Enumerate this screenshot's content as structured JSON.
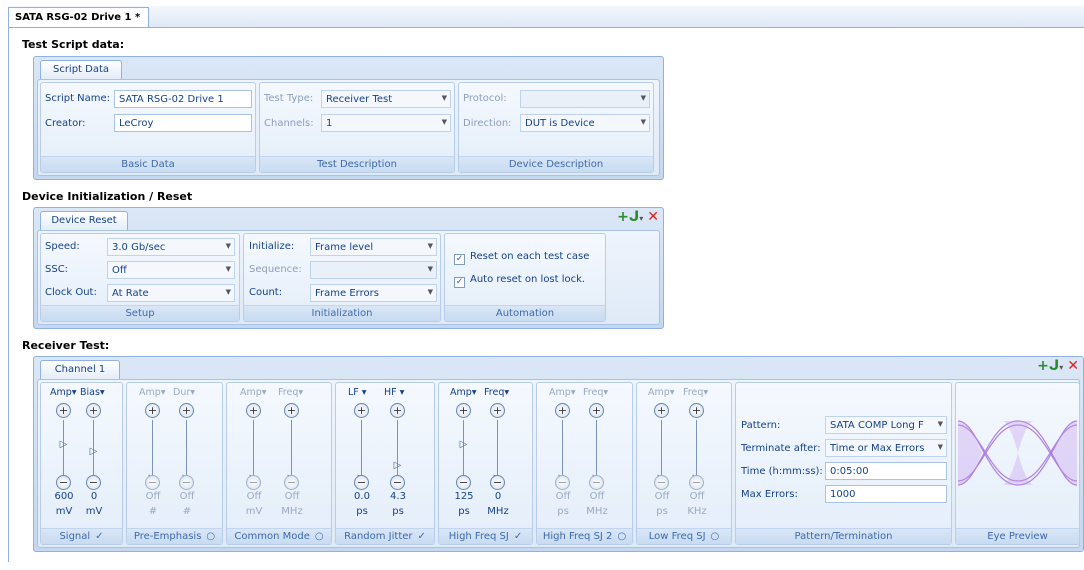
{
  "document_tab": "SATA RSG-02 Drive 1 *",
  "sections": {
    "test_script": "Test Script data:",
    "device_init": "Device Initialization / Reset",
    "receiver": "Receiver Test:"
  },
  "script_data": {
    "tab": "Script Data",
    "basic": {
      "script_name_label": "Script Name:",
      "script_name": "SATA RSG-02 Drive 1",
      "creator_label": "Creator:",
      "creator": "LeCroy",
      "group": "Basic Data"
    },
    "test_desc": {
      "test_type_label": "Test Type:",
      "test_type": "Receiver Test",
      "channels_label": "Channels:",
      "channels": "1",
      "group": "Test Description"
    },
    "device_desc": {
      "protocol_label": "Protocol:",
      "protocol": "",
      "direction_label": "Direction:",
      "direction": "DUT is Device",
      "group": "Device Description"
    }
  },
  "device_reset": {
    "tab": "Device Reset",
    "setup": {
      "speed_label": "Speed:",
      "speed": "3.0 Gb/sec",
      "ssc_label": "SSC:",
      "ssc": "Off",
      "clock_label": "Clock Out:",
      "clock": "At Rate",
      "group": "Setup"
    },
    "init": {
      "initialize_label": "Initialize:",
      "initialize": "Frame level",
      "sequence_label": "Sequence:",
      "sequence": "",
      "count_label": "Count:",
      "count": "Frame Errors",
      "group": "Initialization"
    },
    "automation": {
      "reset_each": "Reset on each test case",
      "auto_reset": "Auto reset on lost lock.",
      "group": "Automation"
    }
  },
  "channel": {
    "tab": "Channel 1",
    "groups": [
      {
        "label": "Signal",
        "status": "✓",
        "h1": "Amp▾",
        "h2": "Bias▾",
        "v1": "600",
        "v2": "0",
        "u1": "mV",
        "u2": "mV",
        "dim": false
      },
      {
        "label": "Pre-Emphasis",
        "status": "○",
        "h1": "Amp▾",
        "h2": "Dur▾",
        "v1": "Off",
        "v2": "Off",
        "u1": "#",
        "u2": "#",
        "dim": true
      },
      {
        "label": "Common Mode",
        "status": "○",
        "h1": "Amp▾",
        "h2": "Freq▾",
        "v1": "Off",
        "v2": "Off",
        "u1": "mV",
        "u2": "MHz",
        "dim": true
      },
      {
        "label": "Random Jitter",
        "status": "✓",
        "h1": "LF ▾",
        "h2": "HF ▾",
        "v1": "0.0",
        "v2": "4.3",
        "u1": "ps",
        "u2": "ps",
        "dim": false
      },
      {
        "label": "High Freq SJ",
        "status": "✓",
        "h1": "Amp▾",
        "h2": "Freq▾",
        "v1": "125",
        "v2": "0",
        "u1": "ps",
        "u2": "MHz",
        "dim": false
      },
      {
        "label": "High Freq SJ 2",
        "status": "○",
        "h1": "Amp▾",
        "h2": "Freq▾",
        "v1": "Off",
        "v2": "Off",
        "u1": "ps",
        "u2": "MHz",
        "dim": true
      },
      {
        "label": "Low Freq SJ",
        "status": "○",
        "h1": "Amp▾",
        "h2": "Freq▾",
        "v1": "Off",
        "v2": "Off",
        "u1": "ps",
        "u2": "KHz",
        "dim": true
      }
    ],
    "pattern": {
      "pattern_label": "Pattern:",
      "pattern": "SATA COMP Long F",
      "terminate_label": "Terminate after:",
      "terminate": "Time or Max Errors",
      "time_label": "Time (h:mm:ss):",
      "time": "0:05:00",
      "max_errors_label": "Max Errors:",
      "max_errors": "1000",
      "group": "Pattern/Termination"
    },
    "eye_group": "Eye Preview"
  }
}
